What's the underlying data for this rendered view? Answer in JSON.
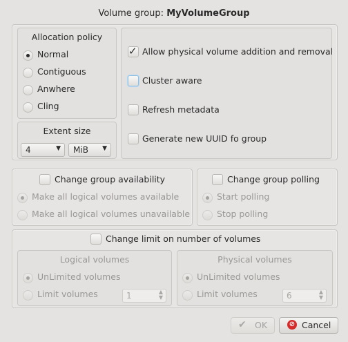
{
  "dialog": {
    "title_prefix": "Volume group:",
    "group_name": "MyVolumeGroup"
  },
  "allocation_policy": {
    "title": "Allocation policy",
    "options": [
      {
        "label": "Normal",
        "selected": true
      },
      {
        "label": "Contiguous",
        "selected": false
      },
      {
        "label": "Anwhere",
        "selected": false
      },
      {
        "label": "Cling",
        "selected": false
      }
    ]
  },
  "extent_size": {
    "title": "Extent size",
    "value": "4",
    "unit": "MiB"
  },
  "options": {
    "allow_pv": {
      "label": "Allow physical volume addition and removal",
      "checked": true
    },
    "cluster_aware": {
      "label": "Cluster aware",
      "checked": false
    },
    "refresh_metadata": {
      "label": "Refresh metadata",
      "checked": false
    },
    "generate_uuid": {
      "label": "Generate new UUID fo group",
      "checked": false
    }
  },
  "availability": {
    "title": "Change group availability",
    "checked": false,
    "options": [
      {
        "label": "Make all logical volumes available",
        "selected": true
      },
      {
        "label": "Make all logical volumes unavailable",
        "selected": false
      }
    ]
  },
  "polling": {
    "title": "Change group polling",
    "checked": false,
    "options": [
      {
        "label": "Start polling",
        "selected": true
      },
      {
        "label": "Stop polling",
        "selected": false
      }
    ]
  },
  "limits": {
    "title": "Change limit on number of volumes",
    "checked": false,
    "logical": {
      "title": "Logical volumes",
      "unlimited_label": "UnLimited volumes",
      "limit_label": "Limit volumes",
      "limit_value": "1"
    },
    "physical": {
      "title": "Physical volumes",
      "unlimited_label": "UnLimited volumes",
      "limit_label": "Limit volumes",
      "limit_value": "6"
    }
  },
  "buttons": {
    "ok": "OK",
    "cancel": "Cancel"
  },
  "colors": {
    "background": "#e4e3e1",
    "cancel_icon": "#d62b2b",
    "focus": "#8fbfe3"
  }
}
